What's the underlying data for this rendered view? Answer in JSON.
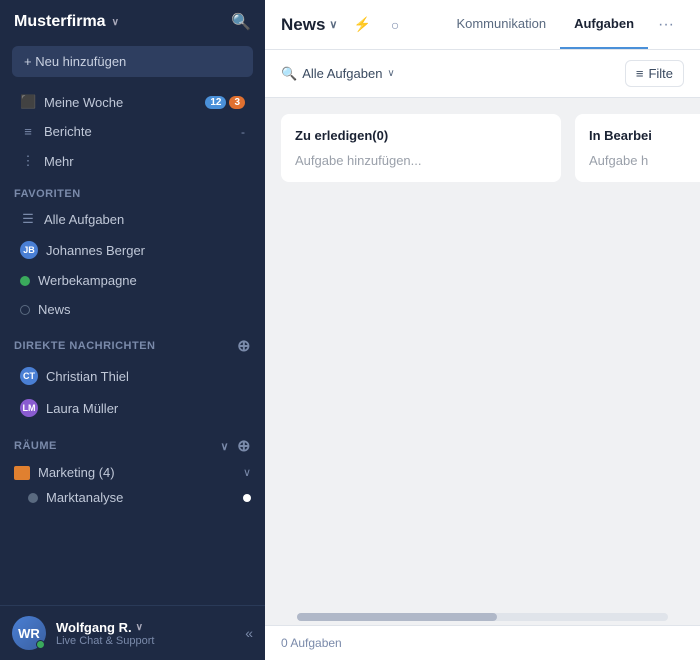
{
  "sidebar": {
    "company_name": "Musterfirma",
    "chevron": "∨",
    "add_button": "+ Neu hinzufügen",
    "nav_items": [
      {
        "id": "meine-woche",
        "icon": "☰",
        "label": "Meine Woche",
        "badge1": "12",
        "badge2": "3"
      },
      {
        "id": "berichte",
        "icon": "≡",
        "label": "Berichte",
        "badge1": "-",
        "badge2": ""
      },
      {
        "id": "mehr",
        "icon": "⋮",
        "label": "Mehr",
        "badge1": "",
        "badge2": ""
      }
    ],
    "favorites_label": "Favoriten",
    "favorites": [
      {
        "id": "alle-aufgaben",
        "icon": "list",
        "label": "Alle Aufgaben"
      },
      {
        "id": "johannes-berger",
        "icon": "avatar",
        "label": "Johannes Berger",
        "color": "blue"
      },
      {
        "id": "werbekampagne",
        "icon": "dot-green",
        "label": "Werbekampagne"
      },
      {
        "id": "news",
        "icon": "dot-empty",
        "label": "News"
      }
    ],
    "dm_label": "Direkte Nachrichten",
    "dm_items": [
      {
        "id": "christian-thiel",
        "label": "Christian Thiel",
        "color": "blue"
      },
      {
        "id": "laura-mueller",
        "label": "Laura Müller",
        "color": "purple"
      }
    ],
    "rooms_label": "Räume",
    "rooms": [
      {
        "id": "marketing",
        "label": "Marketing (4)"
      }
    ],
    "sub_rooms": [
      {
        "id": "marktanalyse",
        "label": "Marktanalyse"
      }
    ],
    "footer": {
      "user_name": "Wolfgang R.",
      "chevron": "∨",
      "status": "Live Chat & Support",
      "collapse_icon": "«"
    }
  },
  "main": {
    "channel_title": "News",
    "channel_chevron": "∨",
    "header_icons": {
      "activity": "⚡",
      "circle": "○"
    },
    "nav_items": [
      {
        "id": "kommunikation",
        "label": "Kommunikation",
        "active": false
      },
      {
        "id": "aufgaben",
        "label": "Aufgaben",
        "active": true
      }
    ],
    "header_more": "···",
    "toolbar": {
      "filter_icon": "≡",
      "filter_label": "Filte",
      "search_icon": "🔍",
      "search_label": "Alle Aufgaben",
      "dropdown_icon": "∨"
    },
    "columns": [
      {
        "id": "zu-erledigen",
        "title": "Zu erledigen(0)",
        "add_text": "Aufgabe hinzufügen..."
      },
      {
        "id": "in-bearbeitung",
        "title": "In Bearbei",
        "add_text": "Aufgabe h"
      }
    ],
    "footer": {
      "task_count": "0 Aufgaben"
    }
  }
}
